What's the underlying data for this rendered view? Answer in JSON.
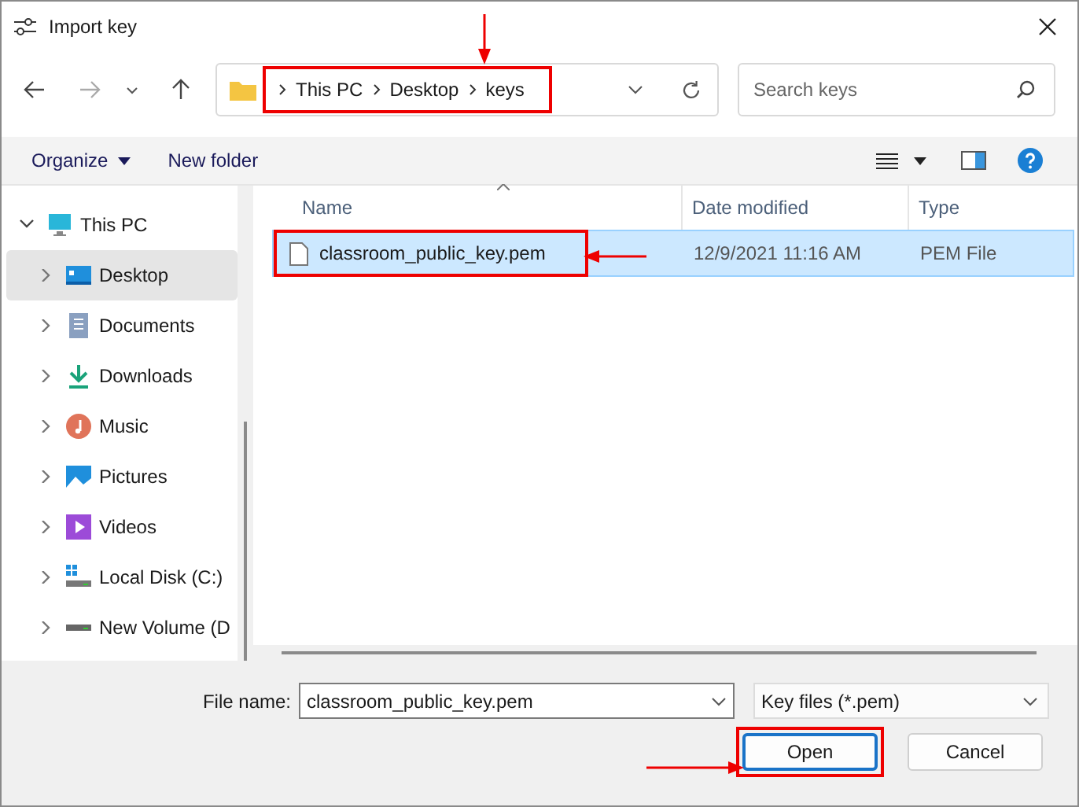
{
  "window": {
    "title": "Import key"
  },
  "address": {
    "crumbs": [
      "This PC",
      "Desktop",
      "keys"
    ],
    "annotated": true
  },
  "search": {
    "placeholder": "Search keys"
  },
  "toolbar": {
    "organize": "Organize",
    "new_folder": "New folder"
  },
  "sidebar": {
    "items": [
      {
        "label": "This PC",
        "kind": "pc",
        "expanded": true,
        "selected": false,
        "children": [
          {
            "label": "Desktop",
            "kind": "desktop",
            "expanded": false,
            "selected": true
          },
          {
            "label": "Documents",
            "kind": "documents",
            "expanded": false,
            "selected": false
          },
          {
            "label": "Downloads",
            "kind": "downloads",
            "expanded": false,
            "selected": false
          },
          {
            "label": "Music",
            "kind": "music",
            "expanded": false,
            "selected": false
          },
          {
            "label": "Pictures",
            "kind": "pictures",
            "expanded": false,
            "selected": false
          },
          {
            "label": "Videos",
            "kind": "videos",
            "expanded": false,
            "selected": false
          },
          {
            "label": "Local Disk (C:)",
            "kind": "disk",
            "expanded": false,
            "selected": false
          },
          {
            "label": "New Volume (D",
            "kind": "drive",
            "expanded": false,
            "selected": false
          }
        ]
      }
    ]
  },
  "table": {
    "columns": [
      "Name",
      "Date modified",
      "Type"
    ],
    "rows": [
      {
        "name": "classroom_public_key.pem",
        "date": "12/9/2021 11:16 AM",
        "type": "PEM File",
        "selected": true,
        "annotated": true
      }
    ]
  },
  "footer": {
    "file_name_label": "File name:",
    "file_name": "classroom_public_key.pem",
    "filter": "Key files (*.pem)",
    "buttons": [
      {
        "label": "Open",
        "default": true,
        "annotated": true
      },
      {
        "label": "Cancel",
        "default": false,
        "annotated": false
      }
    ]
  }
}
